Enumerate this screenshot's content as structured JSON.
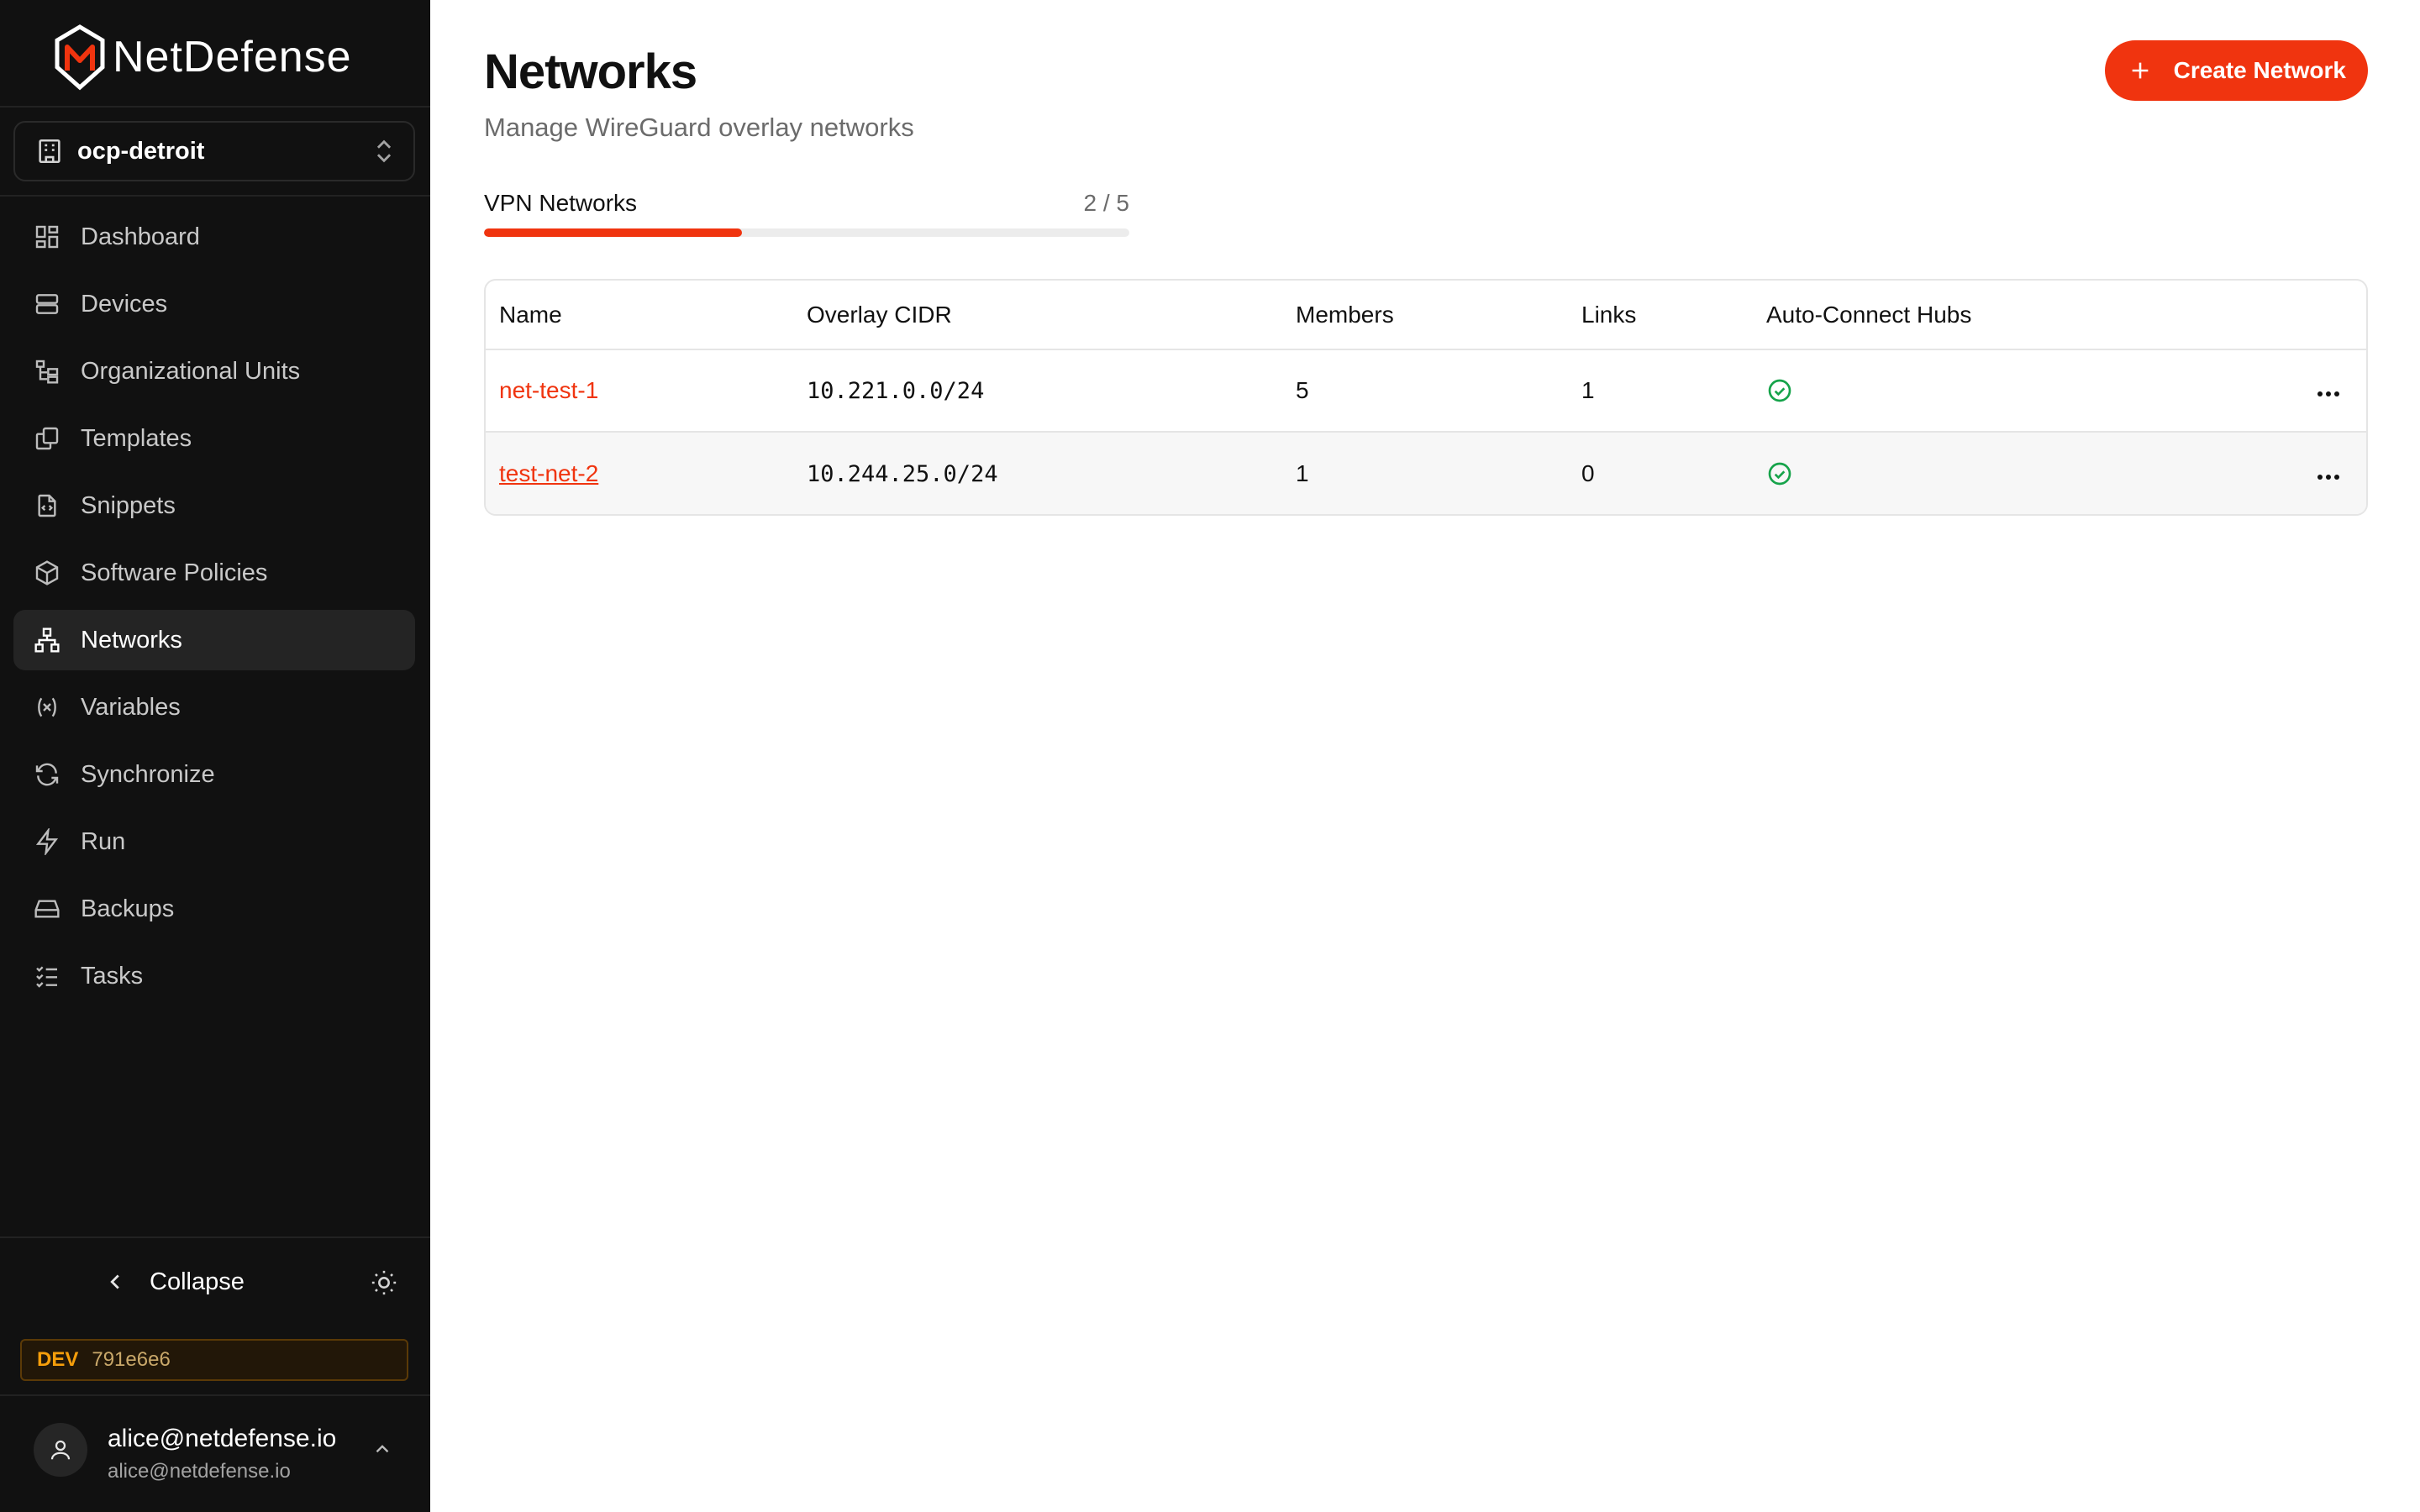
{
  "app": {
    "brand": "NetDefense",
    "org": "ocp-detroit"
  },
  "sidebar": {
    "items": [
      {
        "label": "Dashboard",
        "icon": "dashboard-icon"
      },
      {
        "label": "Devices",
        "icon": "server-icon"
      },
      {
        "label": "Organizational Units",
        "icon": "tree-icon"
      },
      {
        "label": "Templates",
        "icon": "copy-icon"
      },
      {
        "label": "Snippets",
        "icon": "file-code-icon"
      },
      {
        "label": "Software Policies",
        "icon": "package-icon"
      },
      {
        "label": "Networks",
        "icon": "network-icon",
        "active": true
      },
      {
        "label": "Variables",
        "icon": "variable-icon"
      },
      {
        "label": "Synchronize",
        "icon": "refresh-icon"
      },
      {
        "label": "Run",
        "icon": "zap-icon"
      },
      {
        "label": "Backups",
        "icon": "hard-drive-icon"
      },
      {
        "label": "Tasks",
        "icon": "list-checks-icon"
      }
    ],
    "collapse_label": "Collapse",
    "env_tag": "DEV",
    "build_hash": "791e6e6",
    "user": {
      "name": "alice@netdefense.io",
      "email": "alice@netdefense.io"
    }
  },
  "header": {
    "title": "Networks",
    "subtitle": "Manage WireGuard overlay networks",
    "create_label": "Create Network"
  },
  "quota": {
    "label": "VPN Networks",
    "count_text": "2 / 5",
    "used": 2,
    "limit": 5
  },
  "table": {
    "columns": [
      "Name",
      "Overlay CIDR",
      "Members",
      "Links",
      "Auto-Connect Hubs"
    ],
    "rows": [
      {
        "name": "net-test-1",
        "cidr": "10.221.0.0/24",
        "members": "5",
        "links": "1",
        "auto_connect": true
      },
      {
        "name": "test-net-2",
        "cidr": "10.244.25.0/24",
        "members": "1",
        "links": "0",
        "auto_connect": true
      }
    ]
  },
  "colors": {
    "accent": "#f0340f",
    "sidebar_bg": "#111111",
    "success": "#16a34a"
  }
}
